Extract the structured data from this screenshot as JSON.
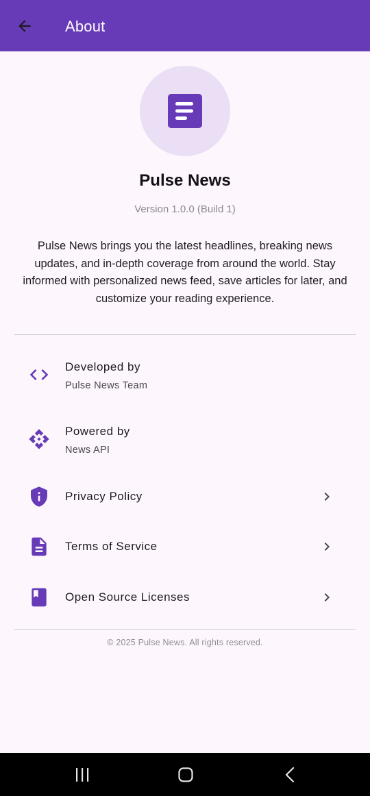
{
  "appbar": {
    "title": "About",
    "back_icon": "arrow-back-icon"
  },
  "app": {
    "logo_icon": "article-icon",
    "name": "Pulse News",
    "version": "Version 1.0.0 (Build 1)",
    "description": "Pulse News brings you the latest headlines, breaking news updates, and in-depth coverage from around the world. Stay informed with personalized news feed, save articles for later, and customize your reading experience."
  },
  "items": [
    {
      "icon": "code-icon",
      "title": "Developed by",
      "subtitle": "Pulse News Team"
    },
    {
      "icon": "api-icon",
      "title": "Powered by",
      "subtitle": "News API"
    },
    {
      "icon": "privacy-shield-icon",
      "title": "Privacy Policy"
    },
    {
      "icon": "document-icon",
      "title": "Terms of Service"
    },
    {
      "icon": "book-icon",
      "title": "Open Source Licenses"
    }
  ],
  "footer": {
    "copyright": "© 2025 Pulse News. All rights reserved."
  },
  "navbar": {
    "recents_icon": "recents-icon",
    "home_icon": "home-icon",
    "back_icon": "system-back-icon"
  },
  "colors": {
    "primary": "#673ab7",
    "background": "#fdf7fd",
    "logo_circle": "#ebdff5"
  }
}
